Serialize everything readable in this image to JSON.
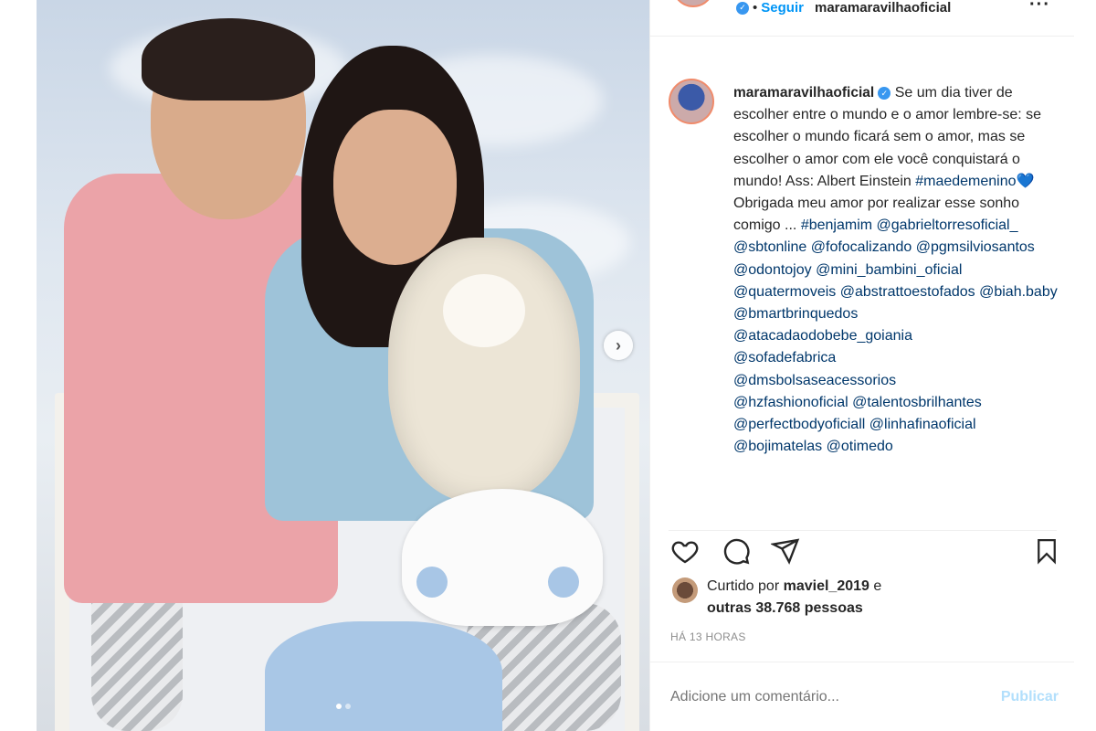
{
  "post": {
    "image_alt": "",
    "carousel": {
      "total": 2,
      "active_index": 0
    }
  },
  "header": {
    "username": "maramaravilhaoficial",
    "separator": "•",
    "follow_label": "Seguir",
    "more_label": "···"
  },
  "caption": {
    "username": "maramaravilhaoficial",
    "text_1": "Se um dia tiver de escolher entre o mundo e o amor lembre-se: se escolher o mundo ficará sem o amor, mas se escolher o amor com ele você conquistará o mundo! Ass: Albert Einstein",
    "hashtag_1": "#maedemenino",
    "emoji": "💙",
    "text_2": "Obrigada meu amor por realizar esse sonho comigo ...",
    "hashtag_2": "#benjamim",
    "mentions": [
      "@gabrieltorresoficial_",
      "@sbtonline",
      "@fofocalizando",
      "@pgmsilviosantos",
      "@odontojoy",
      "@mini_bambini_oficial",
      "@quatermoveis",
      "@abstrattoestofados",
      "@biah.baby",
      "@bmartbrinquedos",
      "@atacadaodobebe_goiania",
      "@sofadefabrica",
      "@dmsbolsaseacessorios",
      "@hzfashionoficial",
      "@talentosbrilhantes",
      "@perfectbodyoficiall",
      "@linhafinaoficial",
      "@bojimatelas",
      "@otimedo"
    ]
  },
  "actions": {
    "like_icon": "heart-icon",
    "comment_icon": "comment-icon",
    "share_icon": "paper-plane-icon",
    "save_icon": "bookmark-icon"
  },
  "likes": {
    "prefix": "Curtido por",
    "user": "maviel_2019",
    "conj": "e",
    "others": "outras 38.768 pessoas"
  },
  "timestamp": "HÁ 13 HORAS",
  "comment": {
    "placeholder": "Adicione um comentário...",
    "publish_label": "Publicar"
  },
  "colors": {
    "link": "#00376b",
    "follow": "#0095f6",
    "publish_disabled": "#b2dffc",
    "verified": "#3897f0"
  }
}
